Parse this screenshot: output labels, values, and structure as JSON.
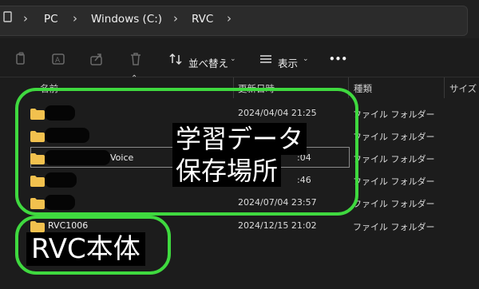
{
  "address_bar": {
    "crumbs": [
      "PC",
      "Windows (C:)",
      "RVC"
    ]
  },
  "toolbar": {
    "sort_label": "並べ替え",
    "view_label": "表示",
    "more_label": "•••"
  },
  "columns": {
    "name": "名前",
    "date": "更新日時",
    "type": "種類",
    "size": "サイズ"
  },
  "rows": [
    {
      "name": "",
      "date": "2024/04/04 21:25",
      "type": "ファイル フォルダー"
    },
    {
      "name": "",
      "date": "",
      "type": "ファイル フォルダー"
    },
    {
      "name": "Voice",
      "date": ":04",
      "type": "ファイル フォルダー"
    },
    {
      "name": "",
      "date": ":46",
      "type": "ファイル フォルダー"
    },
    {
      "name": "",
      "date": "2024/07/04 23:57",
      "type": "ファイル フォルダー"
    },
    {
      "name": "RVC1006",
      "date": "2024/12/15 21:02",
      "type": "ファイル フォルダー"
    }
  ],
  "annotations": {
    "training_line1": "学習データ",
    "training_line2": "保存場所",
    "rvc_main": "RVC本体"
  },
  "colors": {
    "highlight_green": "#3fd93f",
    "folder_yellow": "#f2c14e"
  }
}
